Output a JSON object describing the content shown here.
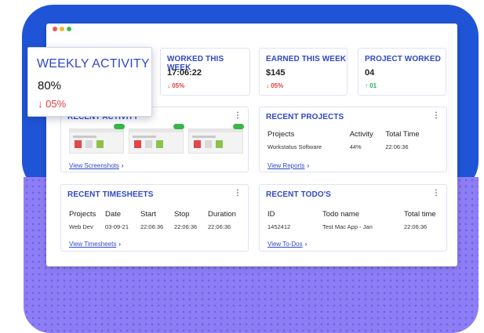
{
  "window_controls": [
    "close",
    "minimize",
    "maximize"
  ],
  "popup": {
    "title": "WEEKLY ACTIVITY",
    "value": "80%",
    "change": "↓ 05%"
  },
  "stats": [
    {
      "title": "WORKED THIS WEEK",
      "value": "17:06:22",
      "change": "↓ 05%",
      "trend": "down"
    },
    {
      "title": "EARNED THIS WEEK",
      "value": "$145",
      "change": "↓ 05%",
      "trend": "down"
    },
    {
      "title": "PROJECT WORKED",
      "value": "04",
      "change": "↑ 01",
      "trend": "up"
    }
  ],
  "recent_activity": {
    "title": "RECENT ACTIVITY",
    "link": "View Screenshots"
  },
  "recent_projects": {
    "title": "RECENT PROJECTS",
    "columns": [
      "Projects",
      "Activity",
      "Total Time"
    ],
    "rows": [
      [
        "Workstatus Software",
        "44%",
        "22:06:36"
      ]
    ],
    "link": "View Reports"
  },
  "recent_timesheets": {
    "title": "RECENT TIMESHEETS",
    "columns": [
      "Projects",
      "Date",
      "Start",
      "Stop",
      "Duration"
    ],
    "rows": [
      [
        "Web Dev",
        "03-09-21",
        "22:06:36",
        "22:06:36",
        "22:06:36"
      ]
    ],
    "link": "View Timesheets"
  },
  "recent_todos": {
    "title": "RECENT TODO'S",
    "columns": [
      "ID",
      "Todo name",
      "Total time"
    ],
    "rows": [
      [
        "1452412",
        "Test Mac App - Jan",
        "22:06:36"
      ]
    ],
    "link": "View To-Dos"
  },
  "colors": {
    "accent": "#2f48c6",
    "blue_bg": "#1f54d6",
    "purple_bg": "#8e7ef6",
    "down": "#e23a3a",
    "up": "#21b05c"
  },
  "icons": {
    "more": "more-vertical-icon",
    "chevron": "chevron-right-icon",
    "arrow_down": "arrow-down-icon",
    "arrow_up": "arrow-up-icon"
  }
}
